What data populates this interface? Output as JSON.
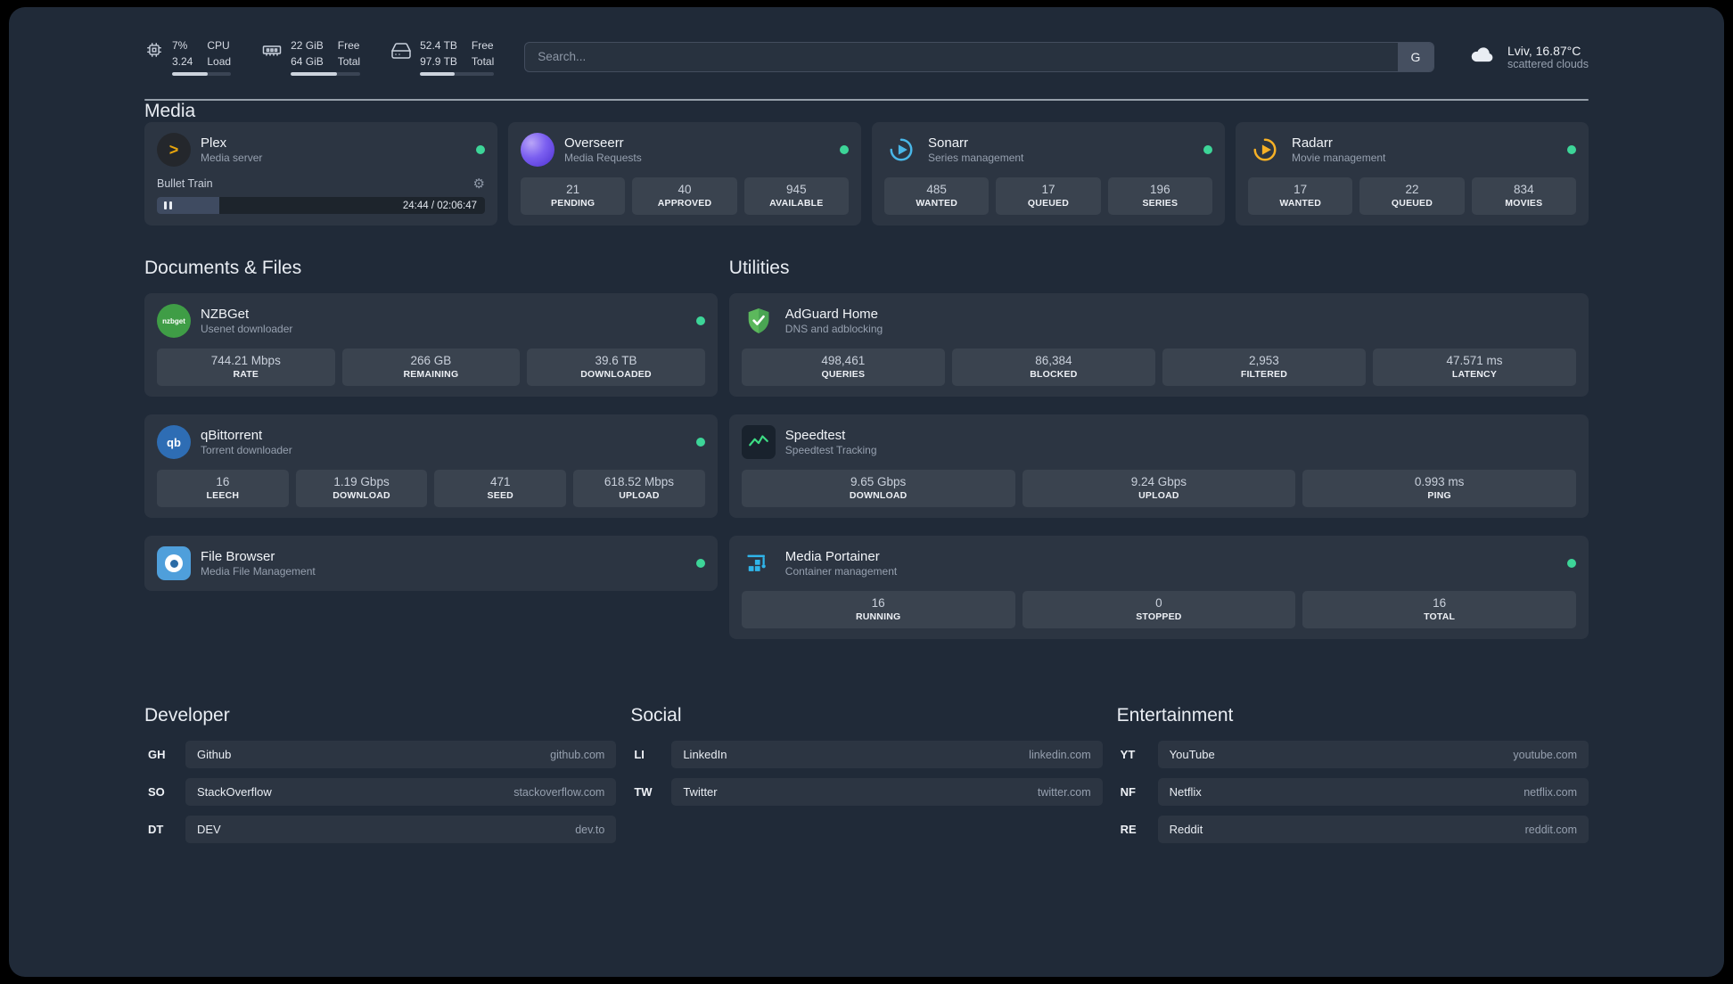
{
  "topbar": {
    "cpu": {
      "percent": "7%",
      "load": "3.24",
      "label_top": "CPU",
      "label_bottom": "Load",
      "bar": 60
    },
    "memory": {
      "free": "22 GiB",
      "total": "64 GiB",
      "label_top": "Free",
      "label_bottom": "Total",
      "bar": 66
    },
    "disk": {
      "free": "52.4 TB",
      "total": "97.9 TB",
      "label_top": "Free",
      "label_bottom": "Total",
      "bar": 47
    },
    "search": {
      "placeholder": "Search...",
      "button_label": "G"
    },
    "weather": {
      "location": "Lviv, 16.87°C",
      "condition": "scattered clouds"
    }
  },
  "sections": {
    "media": {
      "heading": "Media",
      "plex": {
        "title": "Plex",
        "subtitle": "Media server",
        "now_playing": "Bullet Train",
        "time": "24:44 / 02:06:47",
        "progress": 19
      },
      "overseerr": {
        "title": "Overseerr",
        "subtitle": "Media Requests",
        "stats": [
          {
            "value": "21",
            "label": "PENDING"
          },
          {
            "value": "40",
            "label": "APPROVED"
          },
          {
            "value": "945",
            "label": "AVAILABLE"
          }
        ]
      },
      "sonarr": {
        "title": "Sonarr",
        "subtitle": "Series management",
        "stats": [
          {
            "value": "485",
            "label": "WANTED"
          },
          {
            "value": "17",
            "label": "QUEUED"
          },
          {
            "value": "196",
            "label": "SERIES"
          }
        ]
      },
      "radarr": {
        "title": "Radarr",
        "subtitle": "Movie management",
        "stats": [
          {
            "value": "17",
            "label": "WANTED"
          },
          {
            "value": "22",
            "label": "QUEUED"
          },
          {
            "value": "834",
            "label": "MOVIES"
          }
        ]
      }
    },
    "documents": {
      "heading": "Documents & Files",
      "nzbget": {
        "title": "NZBGet",
        "subtitle": "Usenet downloader",
        "icon_text": "nzbget",
        "stats": [
          {
            "value": "744.21 Mbps",
            "label": "RATE"
          },
          {
            "value": "266 GB",
            "label": "REMAINING"
          },
          {
            "value": "39.6 TB",
            "label": "DOWNLOADED"
          }
        ]
      },
      "qbittorrent": {
        "title": "qBittorrent",
        "subtitle": "Torrent downloader",
        "icon_text": "qb",
        "stats": [
          {
            "value": "16",
            "label": "LEECH"
          },
          {
            "value": "1.19 Gbps",
            "label": "DOWNLOAD"
          },
          {
            "value": "471",
            "label": "SEED"
          },
          {
            "value": "618.52 Mbps",
            "label": "UPLOAD"
          }
        ]
      },
      "filebrowser": {
        "title": "File Browser",
        "subtitle": "Media File Management"
      }
    },
    "utilities": {
      "heading": "Utilities",
      "adguard": {
        "title": "AdGuard Home",
        "subtitle": "DNS and adblocking",
        "stats": [
          {
            "value": "498,461",
            "label": "QUERIES"
          },
          {
            "value": "86,384",
            "label": "BLOCKED"
          },
          {
            "value": "2,953",
            "label": "FILTERED"
          },
          {
            "value": "47.571 ms",
            "label": "LATENCY"
          }
        ]
      },
      "speedtest": {
        "title": "Speedtest",
        "subtitle": "Speedtest Tracking",
        "stats": [
          {
            "value": "9.65 Gbps",
            "label": "DOWNLOAD"
          },
          {
            "value": "9.24 Gbps",
            "label": "UPLOAD"
          },
          {
            "value": "0.993 ms",
            "label": "PING"
          }
        ]
      },
      "portainer": {
        "title": "Media Portainer",
        "subtitle": "Container management",
        "stats": [
          {
            "value": "16",
            "label": "RUNNING"
          },
          {
            "value": "0",
            "label": "STOPPED"
          },
          {
            "value": "16",
            "label": "TOTAL"
          }
        ]
      }
    }
  },
  "bookmarks": {
    "developer": {
      "heading": "Developer",
      "items": [
        {
          "abbr": "GH",
          "name": "Github",
          "url": "github.com"
        },
        {
          "abbr": "SO",
          "name": "StackOverflow",
          "url": "stackoverflow.com"
        },
        {
          "abbr": "DT",
          "name": "DEV",
          "url": "dev.to"
        }
      ]
    },
    "social": {
      "heading": "Social",
      "items": [
        {
          "abbr": "LI",
          "name": "LinkedIn",
          "url": "linkedin.com"
        },
        {
          "abbr": "TW",
          "name": "Twitter",
          "url": "twitter.com"
        }
      ]
    },
    "entertainment": {
      "heading": "Entertainment",
      "items": [
        {
          "abbr": "YT",
          "name": "YouTube",
          "url": "youtube.com"
        },
        {
          "abbr": "NF",
          "name": "Netflix",
          "url": "netflix.com"
        },
        {
          "abbr": "RE",
          "name": "Reddit",
          "url": "reddit.com"
        }
      ]
    }
  },
  "colors": {
    "status_online": "#3dd598",
    "plex_accent": "#e8a50c",
    "overseerr_purple": "#5b3fd4",
    "sonarr_blue": "#49b7e8",
    "radarr_amber": "#f7b126",
    "nzbget_green": "#3f9d46",
    "qbittorrent_blue": "#2e6db4",
    "filebrowser_blue": "#4f9fdb",
    "adguard_green": "#5cb85c",
    "speedtest_green": "#3ddc84",
    "portainer_blue": "#2fb5ea"
  }
}
